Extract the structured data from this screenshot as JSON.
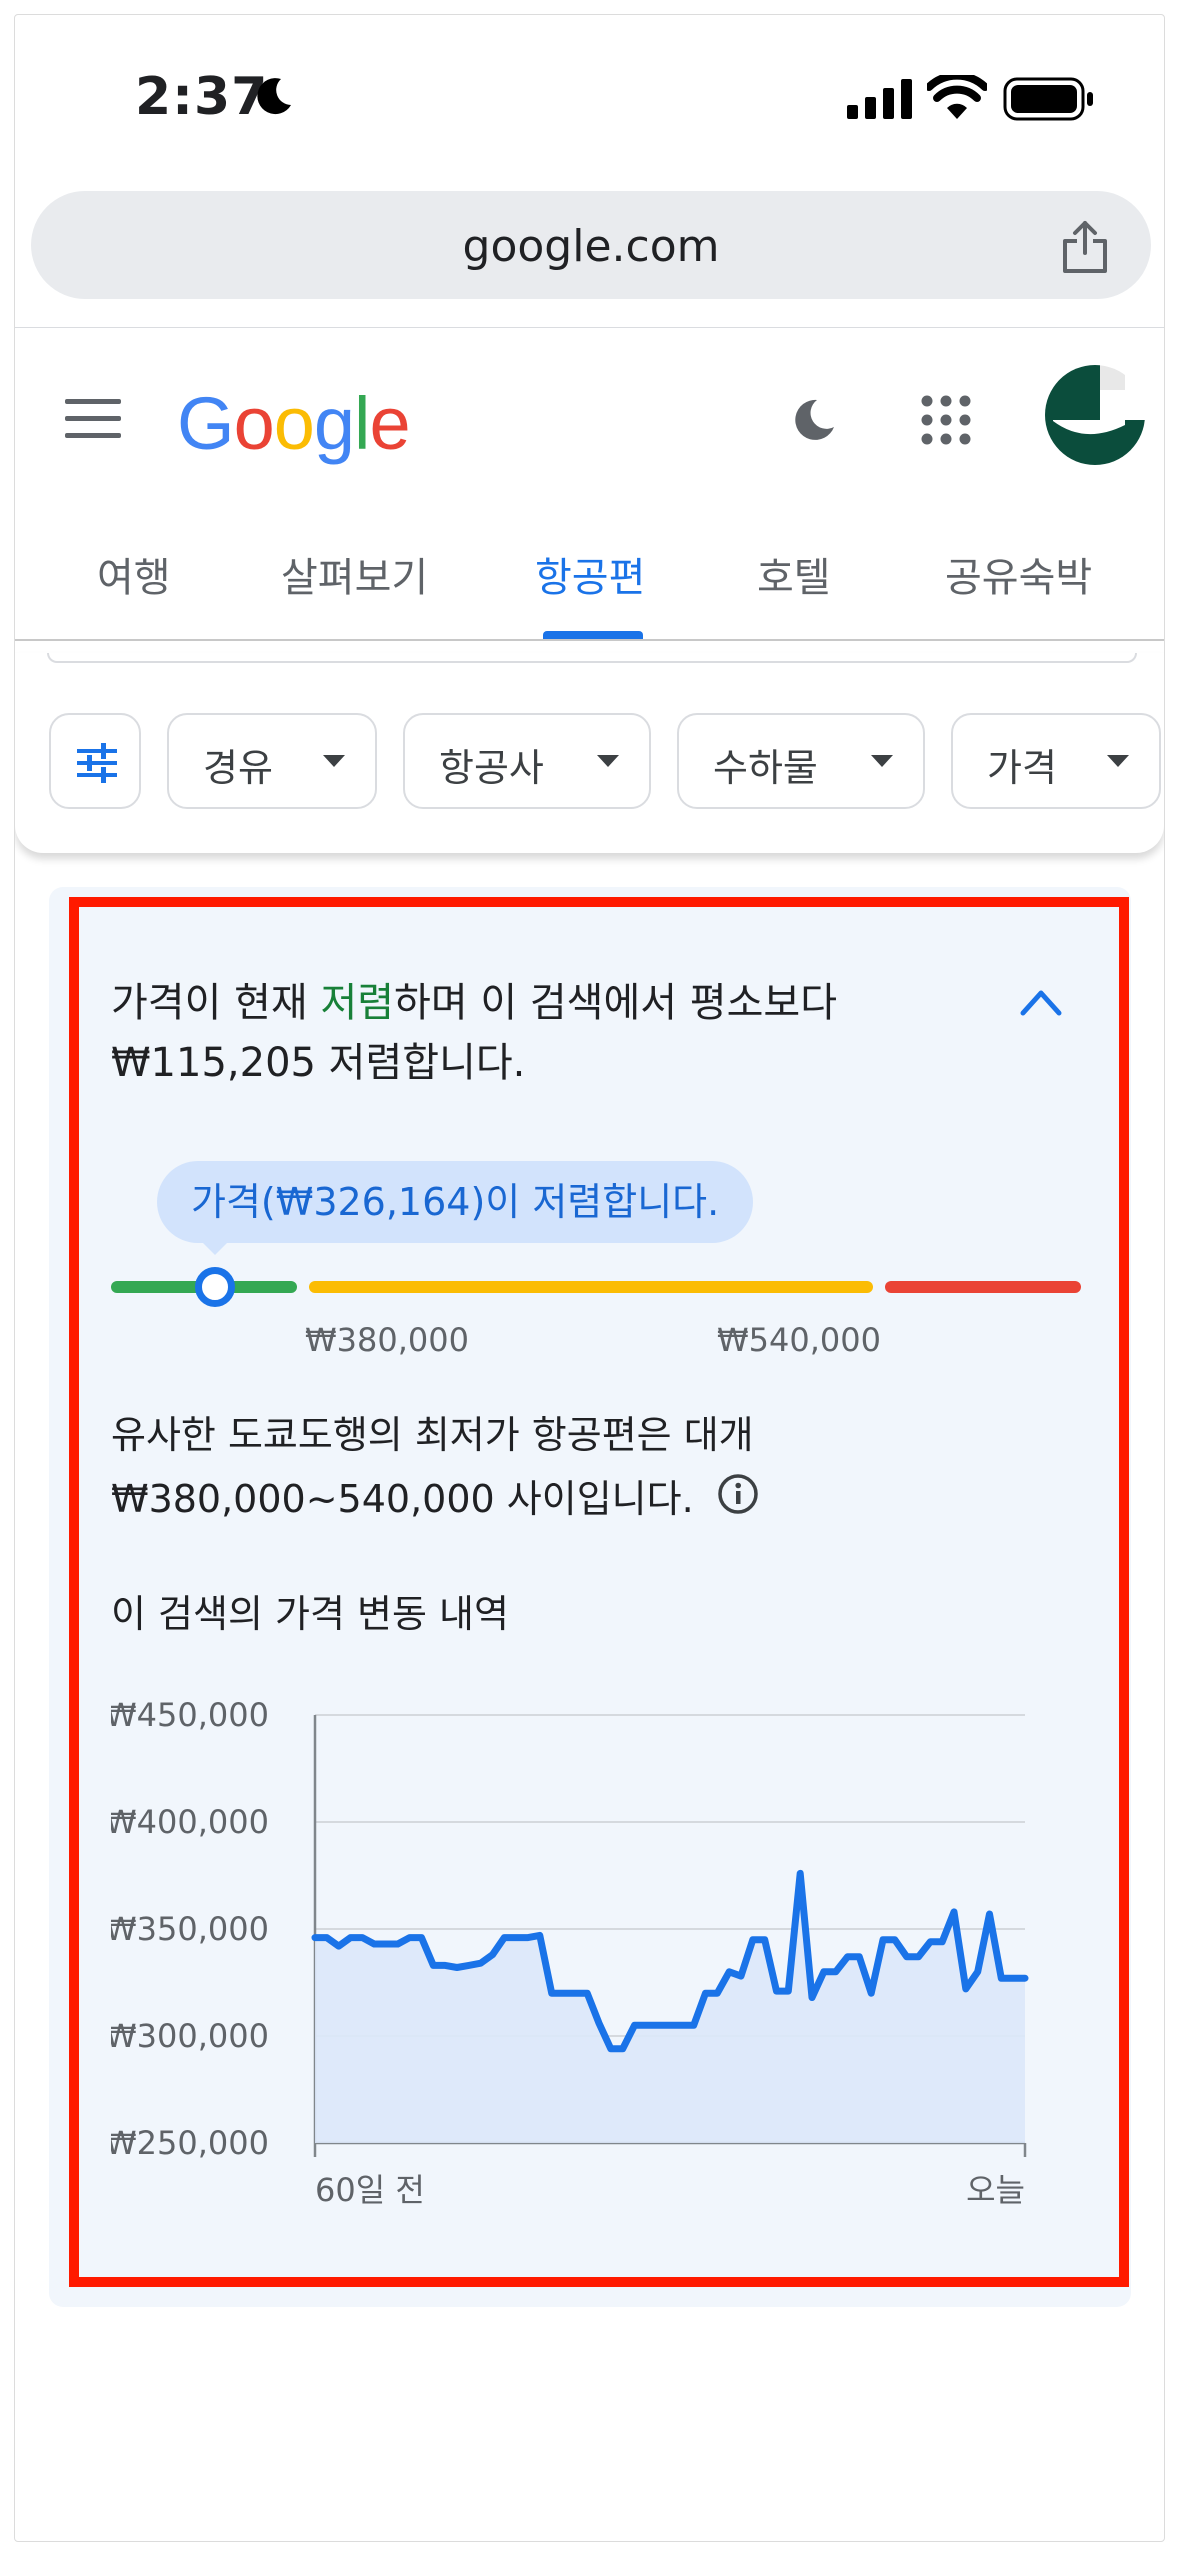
{
  "status_bar": {
    "time": "2:37"
  },
  "address_bar": {
    "url": "google.com"
  },
  "header": {
    "logo_letters": [
      {
        "ch": "G",
        "color": "#4285f4"
      },
      {
        "ch": "o",
        "color": "#ea4335"
      },
      {
        "ch": "o",
        "color": "#fbbc04"
      },
      {
        "ch": "g",
        "color": "#4285f4"
      },
      {
        "ch": "l",
        "color": "#34a853"
      },
      {
        "ch": "e",
        "color": "#ea4335"
      }
    ]
  },
  "tabs": [
    {
      "label": "여행",
      "active": false
    },
    {
      "label": "살펴보기",
      "active": false
    },
    {
      "label": "항공편",
      "active": true
    },
    {
      "label": "호텔",
      "active": false
    },
    {
      "label": "공유숙박",
      "active": false
    }
  ],
  "filters": [
    {
      "label": "경유"
    },
    {
      "label": "항공사"
    },
    {
      "label": "수하물"
    },
    {
      "label": "가격"
    }
  ],
  "insight": {
    "headline_pre": "가격이 현재 ",
    "headline_green": "저렴",
    "headline_post": "하며 이 검색에서 평소보다 ₩115,205 저렴합니다.",
    "bubble": "가격(₩326,164)이 저렴합니다.",
    "low_tick": "₩380,000",
    "high_tick": "₩540,000",
    "range_text": "유사한 도쿄도행의 최저가 항공편은 대개 ₩380,000~540,000 사이입니다.",
    "history_title": "이 검색의 가격 변동 내역"
  },
  "colors": {
    "accent": "#1a73e8",
    "cheap": "#34a853",
    "typical": "#fbbc04",
    "expensive": "#ea4335",
    "highlight_box": "#ff1a00"
  },
  "chart_data": {
    "type": "line",
    "ylim": [
      250000,
      450000
    ],
    "y_ticks": [
      "₩450,000",
      "₩400,000",
      "₩350,000",
      "₩300,000",
      "₩250,000"
    ],
    "y_tick_values": [
      450000,
      400000,
      350000,
      300000,
      250000
    ],
    "x_labels": [
      "60일 전",
      "오늘"
    ],
    "x": [
      0,
      1,
      2,
      3,
      4,
      5,
      6,
      7,
      8,
      9,
      10,
      11,
      12,
      13,
      14,
      15,
      16,
      17,
      18,
      19,
      20,
      21,
      22,
      23,
      24,
      25,
      26,
      27,
      28,
      29,
      30,
      31,
      32,
      33,
      34,
      35,
      36,
      37,
      38,
      39,
      40,
      41,
      42,
      43,
      44,
      45,
      46,
      47,
      48,
      49,
      50,
      51,
      52,
      53,
      54,
      55,
      56,
      57,
      58,
      59,
      60
    ],
    "values": [
      346000,
      346000,
      342000,
      346000,
      346000,
      343000,
      343000,
      343000,
      346000,
      346000,
      333000,
      333000,
      332000,
      333000,
      334000,
      338000,
      346000,
      346000,
      346000,
      347000,
      320000,
      320000,
      320000,
      320000,
      306000,
      294000,
      294000,
      305000,
      305000,
      305000,
      305000,
      305000,
      305000,
      320000,
      320000,
      330000,
      328000,
      345000,
      345000,
      321000,
      321000,
      376000,
      318000,
      330000,
      330000,
      337000,
      337000,
      320000,
      345000,
      345000,
      337000,
      337000,
      344000,
      344000,
      358000,
      322000,
      330000,
      357000,
      327000,
      327000,
      327000
    ],
    "last_point_index": 58,
    "fill": true
  }
}
